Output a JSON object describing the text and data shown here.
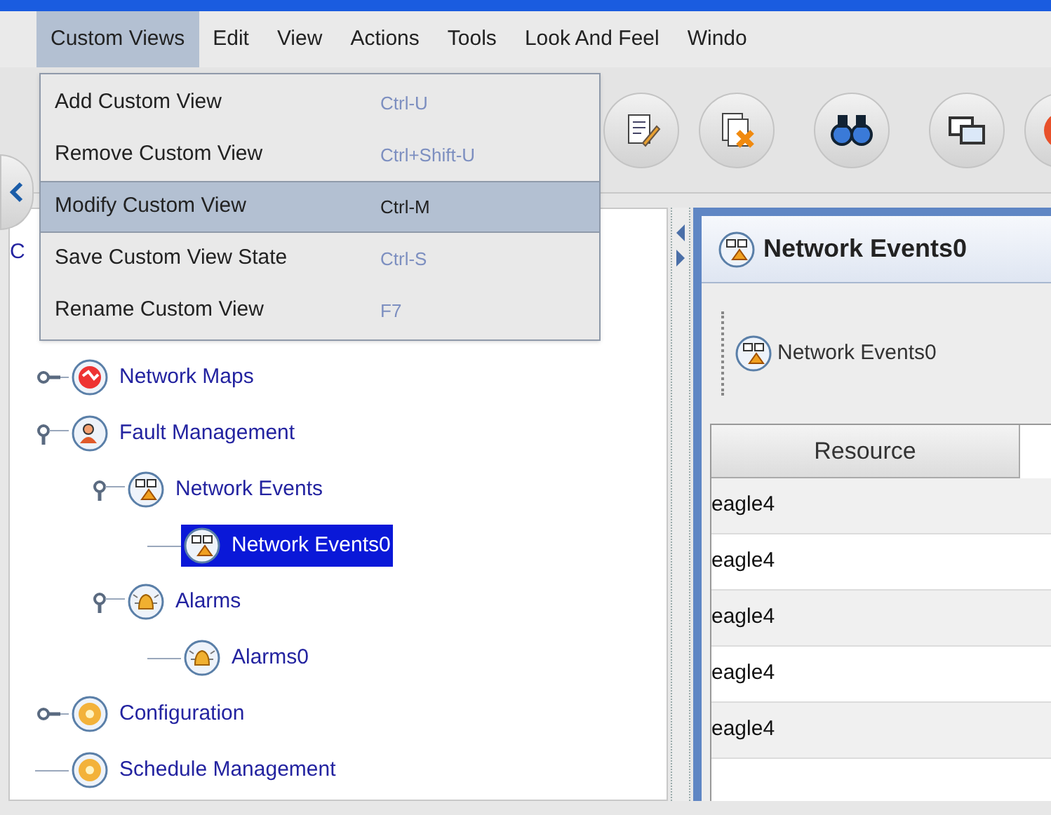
{
  "menubar": [
    {
      "label": "Custom Views",
      "selected": true
    },
    {
      "label": "Edit",
      "selected": false
    },
    {
      "label": "View",
      "selected": false
    },
    {
      "label": "Actions",
      "selected": false
    },
    {
      "label": "Tools",
      "selected": false
    },
    {
      "label": "Look And Feel",
      "selected": false
    },
    {
      "label": "Windo",
      "selected": false
    }
  ],
  "menu": [
    {
      "label": "Add Custom View",
      "shortcut": "Ctrl-U",
      "selected": false
    },
    {
      "label": "Remove Custom View",
      "shortcut": "Ctrl+Shift-U",
      "selected": false
    },
    {
      "label": "Modify Custom View",
      "shortcut": "Ctrl-M",
      "selected": true
    },
    {
      "label": "Save Custom View State",
      "shortcut": "Ctrl-S",
      "selected": false
    },
    {
      "label": "Rename Custom View",
      "shortcut": "F7",
      "selected": false
    }
  ],
  "tree_header": "C",
  "tree": [
    {
      "label": "Network Maps",
      "kind": "map",
      "expanded": false,
      "selected": false
    },
    {
      "label": "Fault Management",
      "kind": "fault",
      "expanded": true,
      "selected": false,
      "children": [
        {
          "label": "Network Events",
          "kind": "events",
          "expanded": true,
          "selected": false,
          "children": [
            {
              "label": "Network Events0",
              "kind": "events",
              "selected": true
            }
          ]
        },
        {
          "label": "Alarms",
          "kind": "alarm",
          "expanded": true,
          "selected": false,
          "children": [
            {
              "label": "Alarms0",
              "kind": "alarm",
              "selected": false
            }
          ]
        }
      ]
    },
    {
      "label": "Configuration",
      "kind": "config",
      "expanded": false,
      "selected": false
    },
    {
      "label": "Schedule Management",
      "kind": "config",
      "selected": false
    }
  ],
  "panel": {
    "title": "Network Events0",
    "toolbar_label": "Network Events0",
    "table": {
      "columns": [
        "Resource"
      ],
      "rows": [
        [
          "eagle4"
        ],
        [
          "eagle4"
        ],
        [
          "eagle4"
        ],
        [
          "eagle4"
        ],
        [
          "eagle4"
        ]
      ]
    }
  }
}
